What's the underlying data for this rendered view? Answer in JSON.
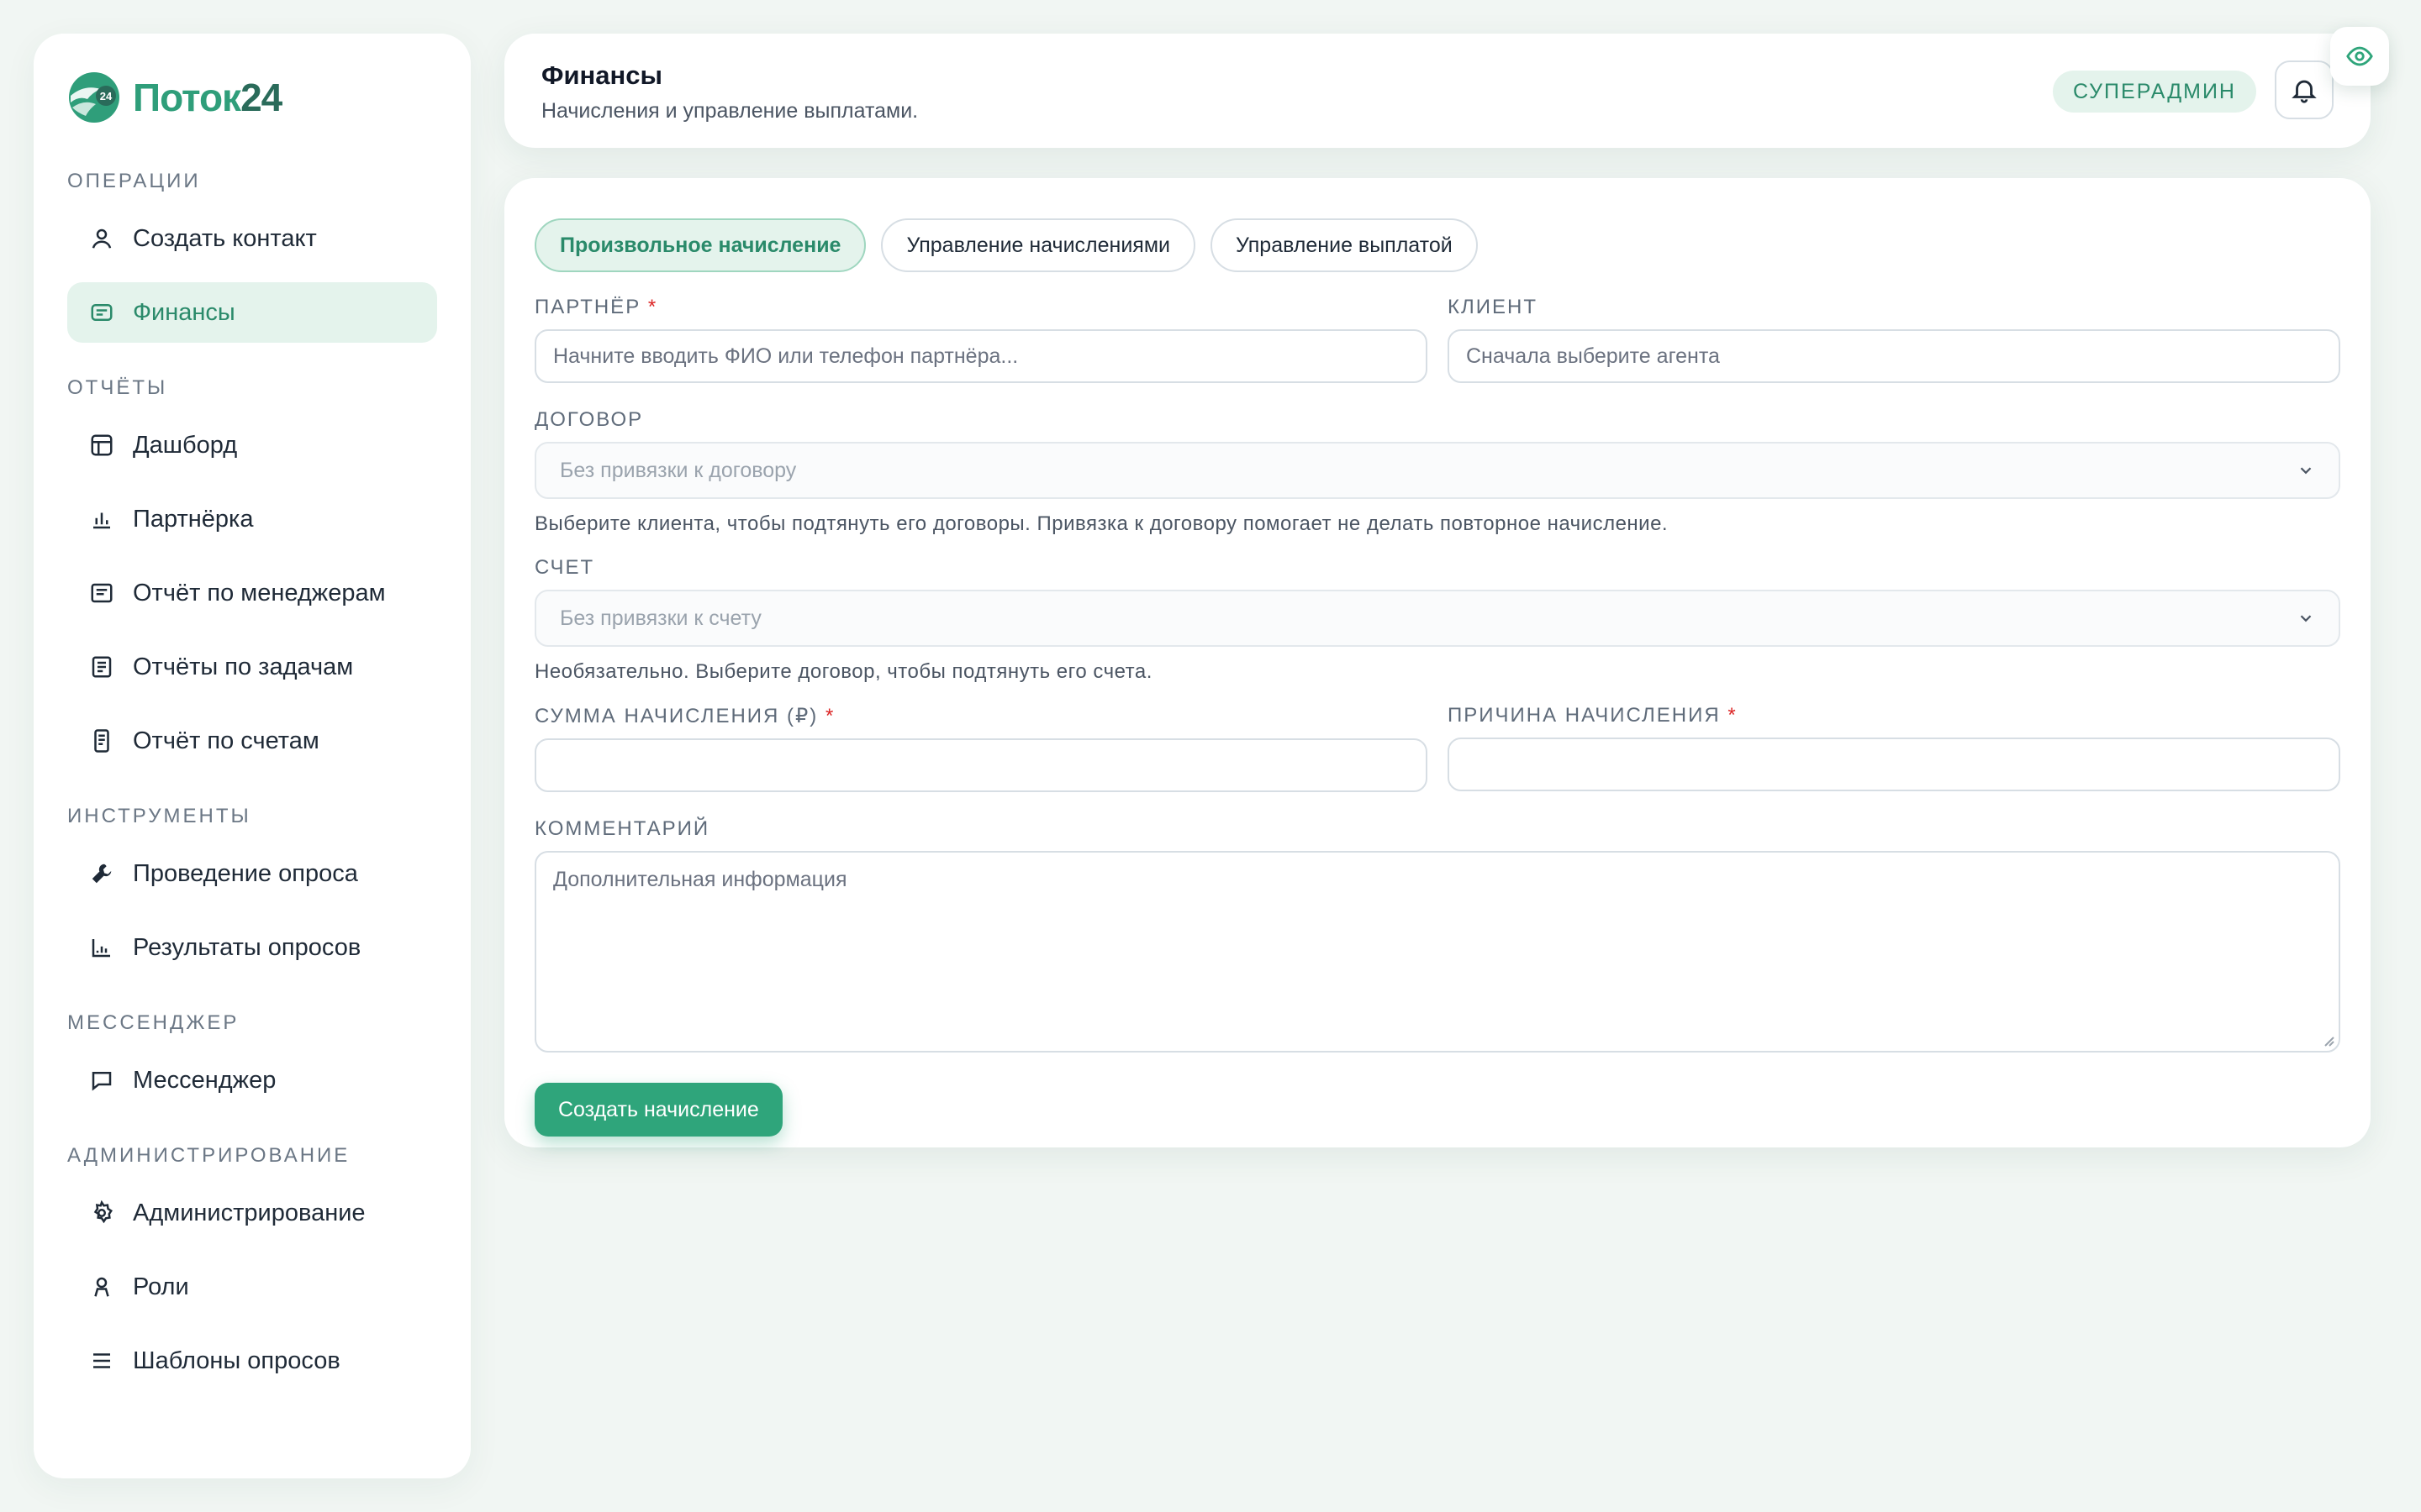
{
  "brand": {
    "name": "Поток",
    "number": "24",
    "mark_text": "24"
  },
  "sidebar": {
    "sections": [
      {
        "title": "Операции",
        "items": [
          {
            "label": "Создать контакт",
            "icon": "user-icon",
            "active": false
          },
          {
            "label": "Финансы",
            "icon": "wallet-icon",
            "active": true
          }
        ]
      },
      {
        "title": "Отчёты",
        "items": [
          {
            "label": "Дашборд",
            "icon": "dashboard-icon",
            "active": false
          },
          {
            "label": "Партнёрка",
            "icon": "bar-chart-icon",
            "active": false
          },
          {
            "label": "Отчёт по менеджерам",
            "icon": "report-icon",
            "active": false
          },
          {
            "label": "Отчёты по задачам",
            "icon": "task-report-icon",
            "active": false
          },
          {
            "label": "Отчёт по счетам",
            "icon": "receipt-icon",
            "active": false
          }
        ]
      },
      {
        "title": "Инструменты",
        "items": [
          {
            "label": "Проведение опроса",
            "icon": "wrench-icon",
            "active": false
          },
          {
            "label": "Результаты опросов",
            "icon": "line-chart-icon",
            "active": false
          }
        ]
      },
      {
        "title": "Мессенджер",
        "items": [
          {
            "label": "Мессенджер",
            "icon": "chat-icon",
            "active": false
          }
        ]
      },
      {
        "title": "Администрирование",
        "items": [
          {
            "label": "Администрирование",
            "icon": "gear-icon",
            "active": false
          },
          {
            "label": "Роли",
            "icon": "role-icon",
            "active": false
          },
          {
            "label": "Шаблоны опросов",
            "icon": "list-icon",
            "active": false
          }
        ]
      }
    ]
  },
  "header": {
    "title": "Финансы",
    "subtitle": "Начисления и управление выплатами.",
    "role": "СУПЕРАДМИН"
  },
  "tabs": [
    {
      "label": "Произвольное начисление",
      "active": true
    },
    {
      "label": "Управление начислениями",
      "active": false
    },
    {
      "label": "Управление выплатой",
      "active": false
    }
  ],
  "form": {
    "partner_label": "Партнёр",
    "partner_placeholder": "Начните вводить ФИО или телефон партнёра...",
    "client_label": "Клиент",
    "client_placeholder": "Сначала выберите агента",
    "contract_label": "Договор",
    "contract_value": "Без привязки к договору",
    "contract_hint": "Выберите клиента, чтобы подтянуть его договоры. Привязка к договору помогает не делать повторное начисление.",
    "account_label": "Счет",
    "account_value": "Без привязки к счету",
    "account_hint": "Необязательно. Выберите договор, чтобы подтянуть его счета.",
    "amount_label": "Сумма начисления (₽)",
    "reason_label": "Причина начисления",
    "comment_label": "Комментарий",
    "comment_placeholder": "Дополнительная информация",
    "required_mark": "*",
    "submit_label": "Создать начисление"
  },
  "colors": {
    "accent": "#2fa57b",
    "accent_soft": "#e4f3ec",
    "required": "#dc2626",
    "background": "#f1f6f3"
  }
}
